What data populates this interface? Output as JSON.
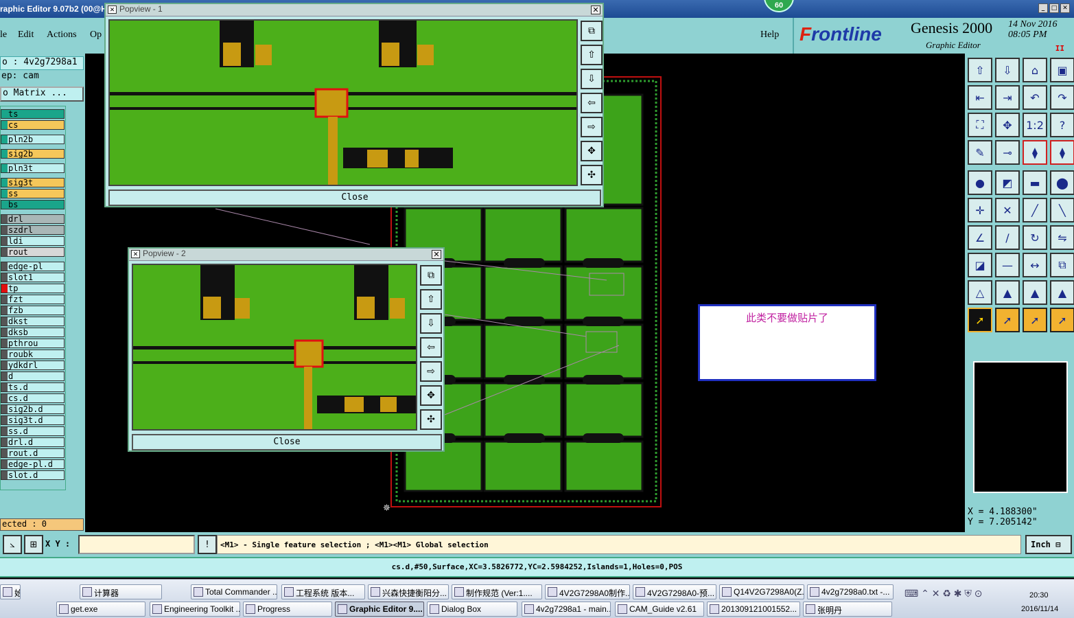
{
  "window": {
    "title": "raphic Editor 9.07b2 (00@H",
    "badge": "60"
  },
  "menu": {
    "file": "le",
    "edit": "Edit",
    "actions": "Actions",
    "options": "Op",
    "help": "Help"
  },
  "brand": {
    "logo_pre": "F",
    "logo_main": "rontline",
    "product": "Genesis 2000",
    "subtitle": "Graphic Editor",
    "date": "14 Nov 2016",
    "time": "08:05 PM",
    "mark": "II"
  },
  "info": {
    "job": "o : 4v2g7298a1",
    "step": "ep: cam",
    "matrix_button": "o Matrix ..."
  },
  "layers": [
    {
      "name": "ts",
      "color": "#1aa58a",
      "marker": "#1aa58a"
    },
    {
      "name": "cs",
      "color": "#f5c75a",
      "marker": "#1aa58a"
    },
    {
      "name": "pln2b",
      "color": "#bff0f0",
      "marker": "#1aa58a"
    },
    {
      "name": "sig2b",
      "color": "#f5c75a",
      "marker": "#1aa58a"
    },
    {
      "name": "pln3t",
      "color": "#bff0f0",
      "marker": "#1aa58a"
    },
    {
      "name": "sig3t",
      "color": "#f5c75a",
      "marker": "#1aa58a"
    },
    {
      "name": "ss",
      "color": "#f5c75a",
      "marker": "#1aa58a"
    },
    {
      "name": "bs",
      "color": "#1aa58a",
      "marker": "#1aa58a"
    },
    {
      "name": "drl",
      "color": "#a9b7b7",
      "marker": "#555"
    },
    {
      "name": "szdrl",
      "color": "#a9b7b7",
      "marker": "#555"
    },
    {
      "name": "ldi",
      "color": "#bff0f0",
      "marker": "#555"
    },
    {
      "name": "rout",
      "color": "#d8d8d8",
      "marker": "#555"
    },
    {
      "name": "edge-pl",
      "color": "#bff0f0",
      "marker": "#555"
    },
    {
      "name": "slot1",
      "color": "#bff0f0",
      "marker": "#555"
    },
    {
      "name": "tp",
      "color": "#bff0f0",
      "marker": "#e01010"
    },
    {
      "name": "fzt",
      "color": "#bff0f0",
      "marker": "#555"
    },
    {
      "name": "fzb",
      "color": "#bff0f0",
      "marker": "#555"
    },
    {
      "name": "dkst",
      "color": "#bff0f0",
      "marker": "#555"
    },
    {
      "name": "dksb",
      "color": "#bff0f0",
      "marker": "#555"
    },
    {
      "name": "pthrou",
      "color": "#bff0f0",
      "marker": "#555"
    },
    {
      "name": "roubk",
      "color": "#bff0f0",
      "marker": "#555"
    },
    {
      "name": "ydkdrl",
      "color": "#bff0f0",
      "marker": "#555"
    },
    {
      "name": "d",
      "color": "#bff0f0",
      "marker": "#555"
    },
    {
      "name": "ts.d",
      "color": "#bff0f0",
      "marker": "#555"
    },
    {
      "name": "cs.d",
      "color": "#bff0f0",
      "marker": "#555"
    },
    {
      "name": "sig2b.d",
      "color": "#bff0f0",
      "marker": "#555"
    },
    {
      "name": "sig3t.d",
      "color": "#bff0f0",
      "marker": "#555"
    },
    {
      "name": "ss.d",
      "color": "#bff0f0",
      "marker": "#555"
    },
    {
      "name": "drl.d",
      "color": "#bff0f0",
      "marker": "#555"
    },
    {
      "name": "rout.d",
      "color": "#bff0f0",
      "marker": "#555"
    },
    {
      "name": "edge-pl.d",
      "color": "#bff0f0",
      "marker": "#555"
    },
    {
      "name": "slot.d",
      "color": "#bff0f0",
      "marker": "#555"
    }
  ],
  "selected": "ected : 0",
  "popup1": {
    "title": "Popview - 1",
    "close": "Close"
  },
  "popup2": {
    "title": "Popview - 2",
    "close": "Close"
  },
  "note": "此类不要做贴片了",
  "coords": {
    "x": "X = 4.188300\"",
    "y": "Y = 7.205142\""
  },
  "prompt": {
    "xy_label": "X Y :",
    "xy_value": "",
    "message": "<M1> - Single feature selection ; <M1><M1> Global selection",
    "unit": "Inch"
  },
  "status": "cs.d,#50,Surface,XC=3.5826772,YC=2.5984252,Islands=1,Holes=0,POS",
  "taskbar": {
    "row1": [
      "始",
      "计算器",
      "Total Commander ...",
      "工程系统  版本...",
      "兴森快捷衡阳分...",
      "制作规范 (Ver:1....",
      "4V2G7298A0制作...",
      "4V2G7298A0-预...",
      "Q14V2G7298A0(Z...",
      "4v2g7298a0.txt -..."
    ],
    "row2": [
      "get.exe",
      "Engineering Toolkit ...",
      "Progress",
      "Graphic Editor 9....",
      "Dialog Box",
      "4v2g7298a1 - main...",
      "CAM_Guide v2.61",
      "201309121001552...",
      "张明丹"
    ],
    "time": "20:30",
    "date": "2016/11/14"
  },
  "icons": {
    "toolbar_right": [
      "open-job-icon",
      "save-icon",
      "home-icon",
      "window-icon",
      "prev-step-icon",
      "next-step-icon",
      "undo-icon",
      "redo-icon",
      "zoom-fit-icon",
      "zoom-center-icon",
      "scale-icon",
      "help-icon",
      "tools-icon",
      "connect-icon",
      "layer-red-icon",
      "layer-red2-icon",
      "point-icon",
      "shape-icon",
      "ruler-icon",
      "circle-icon",
      "select-icon",
      "cross-icon",
      "line-icon",
      "arc-icon",
      "angle-icon",
      "slash-icon",
      "rotate-icon",
      "mirror-icon",
      "snap-icon",
      "minus-icon",
      "measure-icon",
      "group-icon",
      "triangle-icon",
      "triangle2-icon",
      "triangle3-icon",
      "triangle4-icon",
      "arrow-black-icon",
      "arrow-orange-icon",
      "arrow-orange2-icon",
      "arrow-orange3-icon"
    ]
  }
}
